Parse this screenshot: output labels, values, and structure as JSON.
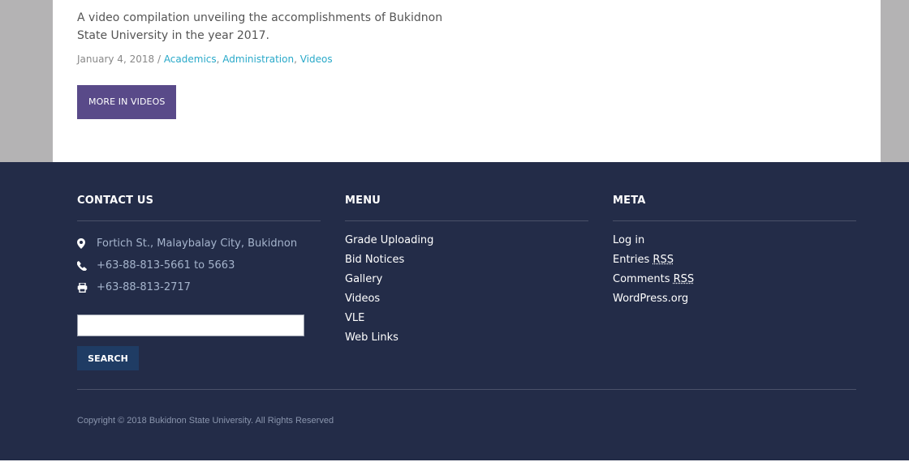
{
  "post": {
    "description": "A video compilation unveiling the accomplishments of Bukidnon State University in the year 2017.",
    "date": "January 4, 2018",
    "separator": "/",
    "categories": [
      "Academics",
      "Administration",
      "Videos"
    ],
    "more_button": "MORE IN VIDEOS"
  },
  "footer": {
    "contact": {
      "title": "CONTACT US",
      "address": "Fortich St., Malaybalay City, Bukidnon",
      "phone": "+63-88-813-5661 to 5663",
      "fax": "+63-88-813-2717",
      "search_button": "SEARCH",
      "search_value": ""
    },
    "menu": {
      "title": "MENU",
      "items": [
        "Grade Uploading",
        "Bid Notices",
        "Gallery",
        "Videos",
        "VLE",
        "Web Links"
      ]
    },
    "meta": {
      "title": "META",
      "login": "Log in",
      "entries": "Entries",
      "comments": "Comments",
      "rss": "RSS",
      "wordpress": "WordPress.org"
    },
    "copyright": "Copyright © 2018 Bukidnon State University. All Rights Reserved"
  },
  "colors": {
    "background": "#b4b3b4",
    "footer": "#232c48",
    "accent_purple": "#594a89",
    "link": "#29a9c9",
    "search_button": "#1f3c64"
  },
  "icons": [
    "map-marker-icon",
    "phone-icon",
    "printer-icon"
  ]
}
